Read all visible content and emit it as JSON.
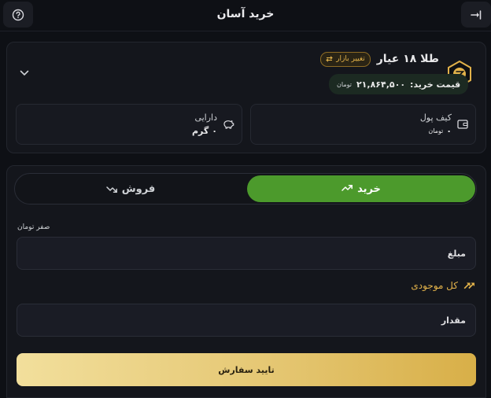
{
  "header": {
    "title": "خرید آسان",
    "left_icon": "help-circle-icon",
    "right_icon": "exit-icon"
  },
  "asset": {
    "name": "طلا ۱۸ عیار",
    "badge": "تغییر بازار",
    "price_label": "قیمت خرید:",
    "price_value": "۲۱,۸۶۴,۵۰۰",
    "price_unit": "تومان"
  },
  "wallet": {
    "label": "کیف پول",
    "value": "۰",
    "unit": "تومان"
  },
  "holdings": {
    "label": "دارایی",
    "value": "۰",
    "unit": "گرم"
  },
  "tabs": {
    "buy": "خرید",
    "sell": "فروش"
  },
  "form": {
    "hint": "صفر تومان",
    "amount_placeholder": "مبلغ",
    "all_balance": "کل موجودی",
    "quantity_placeholder": "مقدار",
    "submit": "تایید سفارش"
  },
  "colors": {
    "accent_green": "#4c9a2c",
    "gold": "#e2b24a",
    "background": "#0e1015"
  }
}
